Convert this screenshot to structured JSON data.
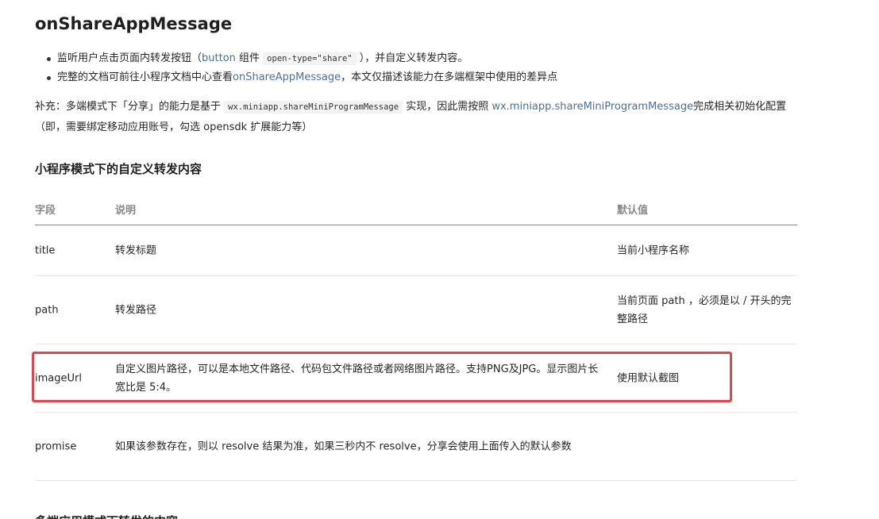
{
  "title": "onShareAppMessage",
  "bullets": {
    "b1": {
      "pre": "监听用户点击页面内转发按钮（",
      "link": "button",
      "mid": " 组件 ",
      "code": "open-type=\"share\"",
      "post": " ），并自定义转发内容。"
    },
    "b2": {
      "pre": "完整的文档可前往小程序文档中心查看",
      "link": "onShareAppMessage",
      "post": "，本文仅描述该能力在多端框架中使用的差异点"
    }
  },
  "note": {
    "pre": "补充：多端模式下「分享」的能力是基于 ",
    "code": "wx.miniapp.shareMiniProgramMessage",
    "mid": " 实现，因此需按照 ",
    "link": "wx.miniapp.shareMiniProgramMessage",
    "post": "完成相关初始化配置（即，需要绑定移动应用账号，勾选 opensdk 扩展能力等）"
  },
  "section_title": "小程序模式下的自定义转发内容",
  "table": {
    "headers": {
      "field": "字段",
      "desc": "说明",
      "default": "默认值"
    },
    "rows": [
      {
        "field": "title",
        "desc": "转发标题",
        "default": "当前小程序名称"
      },
      {
        "field": "path",
        "desc": "转发路径",
        "default": "当前页面 path ，必须是以 / 开头的完整路径"
      },
      {
        "field": "imageUrl",
        "desc": "自定义图片路径，可以是本地文件路径、代码包文件路径或者网络图片路径。支持PNG及JPG。显示图片长宽比是 5:4。",
        "default": "使用默认截图"
      },
      {
        "field": "promise",
        "desc": "如果该参数存在，则以 resolve 结果为准，如果三秒内不 resolve，分享会使用上面传入的默认参数",
        "default": ""
      }
    ]
  },
  "next_section_title": "多端应用模式下转发的内容",
  "colors": {
    "link": "#4a6fa5",
    "highlight": "#e0464b"
  }
}
